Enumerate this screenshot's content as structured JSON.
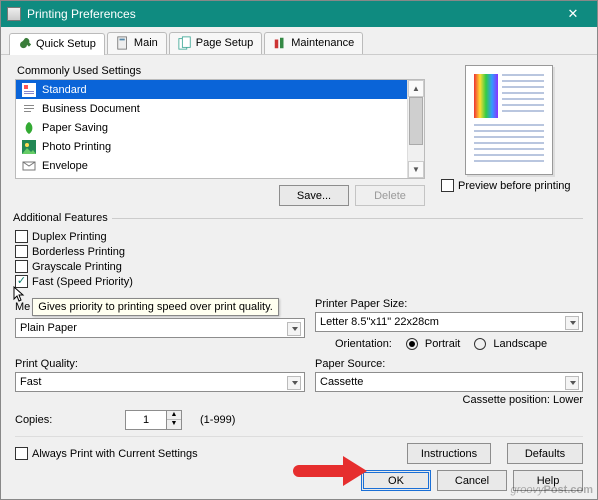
{
  "window": {
    "title": "Printing Preferences"
  },
  "tabs": {
    "quick": "Quick Setup",
    "main": "Main",
    "page": "Page Setup",
    "maint": "Maintenance"
  },
  "commonly": {
    "label": "Commonly Used Settings",
    "items": [
      "Standard",
      "Business Document",
      "Paper Saving",
      "Photo Printing",
      "Envelope"
    ],
    "save": "Save...",
    "delete": "Delete"
  },
  "preview": {
    "label": "Preview before printing"
  },
  "features": {
    "label": "Additional Features",
    "duplex": "Duplex Printing",
    "borderless": "Borderless Printing",
    "grayscale": "Grayscale Printing",
    "fast": "Fast (Speed Priority)",
    "fast_tooltip": "Gives priority to printing speed over print quality."
  },
  "media": {
    "label_short": "Me",
    "value": "Plain Paper"
  },
  "papersize": {
    "label": "Printer Paper Size:",
    "value": "Letter 8.5\"x11\" 22x28cm"
  },
  "orientation": {
    "label": "Orientation:",
    "portrait": "Portrait",
    "landscape": "Landscape"
  },
  "quality": {
    "label": "Print Quality:",
    "value": "Fast"
  },
  "source": {
    "label": "Paper Source:",
    "value": "Cassette",
    "note": "Cassette position: Lower"
  },
  "copies": {
    "label": "Copies:",
    "value": "1",
    "range": "(1-999)"
  },
  "always": {
    "label": "Always Print with Current Settings"
  },
  "buttons": {
    "instructions": "Instructions",
    "defaults": "Defaults",
    "ok": "OK",
    "cancel": "Cancel",
    "help": "Help"
  },
  "watermark": {
    "a": "groovy",
    "b": "Post.com"
  }
}
